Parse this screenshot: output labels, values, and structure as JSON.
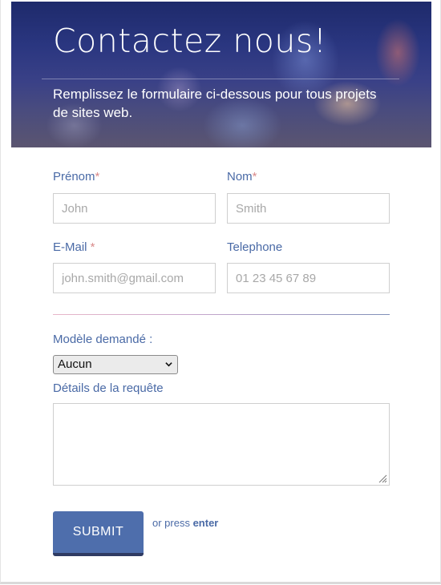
{
  "header": {
    "title": "Contactez nous!",
    "subtitle": "Remplissez le formulaire ci-dessous pour tous projets de sites web."
  },
  "form": {
    "first_name": {
      "label": "Prénom",
      "required_mark": "*",
      "placeholder": "John",
      "value": ""
    },
    "last_name": {
      "label": "Nom",
      "required_mark": "*",
      "placeholder": "Smith",
      "value": ""
    },
    "email": {
      "label": "E-Mail ",
      "required_mark": "*",
      "placeholder": "john.smith@gmail.com",
      "value": ""
    },
    "phone": {
      "label": "Telephone",
      "placeholder": "01 23 45 67 89",
      "value": ""
    },
    "model": {
      "label": "Modèle demandé :",
      "selected": "Aucun"
    },
    "details": {
      "label": "Détails de la requête",
      "value": ""
    },
    "submit_label": "SUBMIT",
    "hint_prefix": "or press ",
    "hint_key": "enter"
  },
  "colors": {
    "accent": "#4e6eac",
    "label": "#4a6aa6",
    "required": "#d98a8a"
  }
}
